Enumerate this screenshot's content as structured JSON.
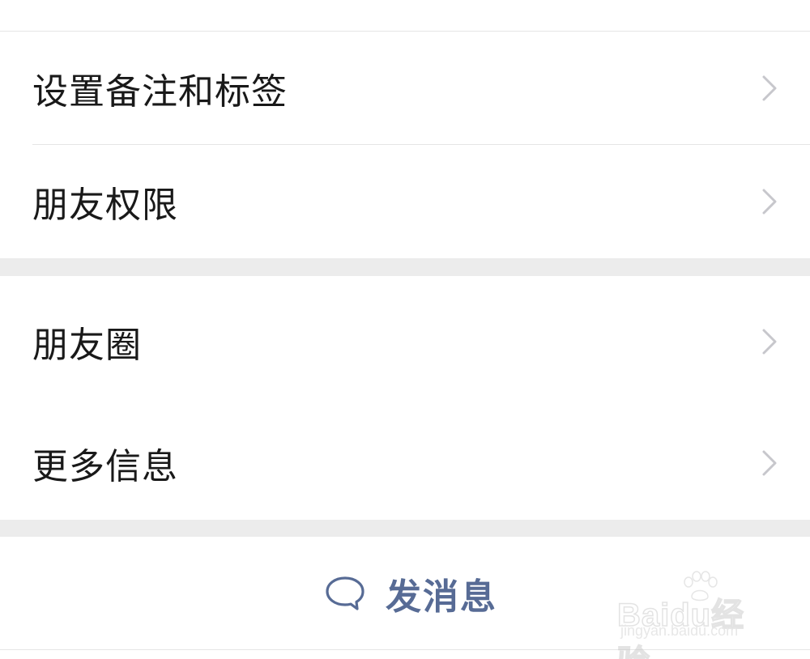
{
  "menu": {
    "group1": [
      {
        "label": "设置备注和标签"
      },
      {
        "label": "朋友权限"
      }
    ],
    "group2": [
      {
        "label": "朋友圈"
      },
      {
        "label": "更多信息"
      }
    ]
  },
  "action": {
    "label": "发消息",
    "icon": "chat-bubble-icon"
  },
  "watermark": {
    "logo_text": "Baidu经验",
    "url": "jingyan.baidu.com"
  },
  "colors": {
    "accent": "#576b95",
    "text": "#191919",
    "separator": "#ececec",
    "chevron": "#c7c7cc"
  }
}
